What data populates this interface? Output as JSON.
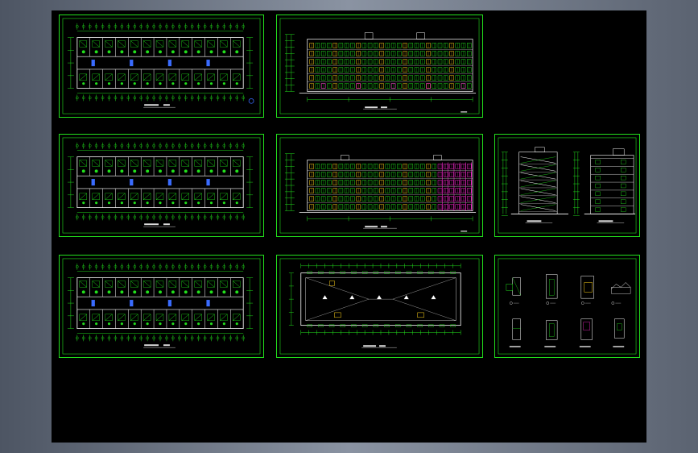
{
  "colors": {
    "background": "#000000",
    "frame": "#22e01c",
    "desktop": "#7a8392",
    "accent_yellow": "#ffd21a",
    "accent_magenta": "#ff2ad4",
    "accent_blue": "#3a6cff"
  },
  "sheets": [
    {
      "id": "plan-1",
      "kind": "floor-plan"
    },
    {
      "id": "elevation-front",
      "kind": "elevation-colored"
    },
    {
      "id": "plan-2",
      "kind": "floor-plan"
    },
    {
      "id": "elevation-rear",
      "kind": "elevation-colored"
    },
    {
      "id": "section",
      "kind": "section"
    },
    {
      "id": "plan-3",
      "kind": "floor-plan"
    },
    {
      "id": "roof-plan",
      "kind": "roof-plan"
    },
    {
      "id": "details",
      "kind": "details"
    }
  ]
}
